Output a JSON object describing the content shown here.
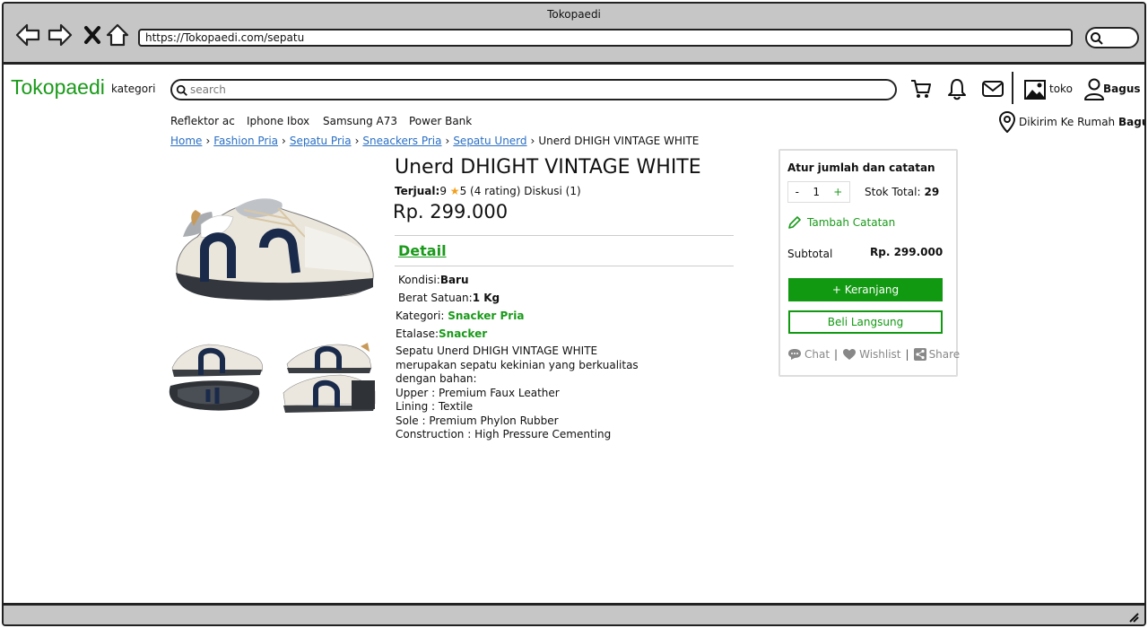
{
  "window": {
    "title": "Tokopaedi"
  },
  "browser": {
    "url": "https://Tokopaedi.com/sepatu"
  },
  "header": {
    "logo": "Tokopaedi",
    "kategori": "kategori",
    "search_placeholder": "search",
    "toko": "toko",
    "user": "Bagus"
  },
  "quick_links": [
    "Reflektor ac",
    "Iphone Ibox",
    "Samsung A73",
    "Power Bank"
  ],
  "shipping": {
    "prefix": "Dikirim Ke Rumah",
    "name": "Bagus"
  },
  "breadcrumb": [
    "Home",
    "Fashion Pria",
    "Sepatu Pria",
    "Sneackers Pria",
    "Sepatu Unerd",
    "Unerd DHIGH VINTAGE WHITE"
  ],
  "product": {
    "title": "Unerd DHIGHT VINTAGE WHITE",
    "sold_label": "Terjual:",
    "sold": "9",
    "rating": "5",
    "rating_count": "(4 rating)",
    "discussion": "Diskusi (1)",
    "price": "Rp. 299.000",
    "detail_tab": "Detail",
    "kondisi_label": "Kondisi:",
    "kondisi": "Baru",
    "berat_label": "Berat Satuan:",
    "berat": "1 Kg",
    "kategori_label": "Kategori:",
    "kategori": "Snacker Pria",
    "etalase_label": "Etalase:",
    "etalase": "Snacker",
    "description": [
      "Sepatu Unerd DHIGH VINTAGE WHITE",
      "merupakan sepatu kekinian yang berkualitas",
      "dengan bahan:",
      "Upper : Premium Faux Leather",
      "Lining : Textile",
      "Sole : Premium Phylon Rubber",
      "Construction : High Pressure Cementing"
    ]
  },
  "purchase": {
    "title": "Atur jumlah dan catatan",
    "minus": "-",
    "qty": "1",
    "plus": "+",
    "stock_label": "Stok Total:",
    "stock": "29",
    "note": "Tambah Catatan",
    "subtotal_label": "Subtotal",
    "subtotal": "Rp. 299.000",
    "cart_button": "+ Keranjang",
    "buy_button": "Beli Langsung",
    "chat": "Chat",
    "wishlist": "Wishlist",
    "share": "Share"
  },
  "colors": {
    "brand": "#1a9a1a",
    "button": "#119911",
    "link": "#2a6fc4",
    "star": "#f2a01c"
  }
}
